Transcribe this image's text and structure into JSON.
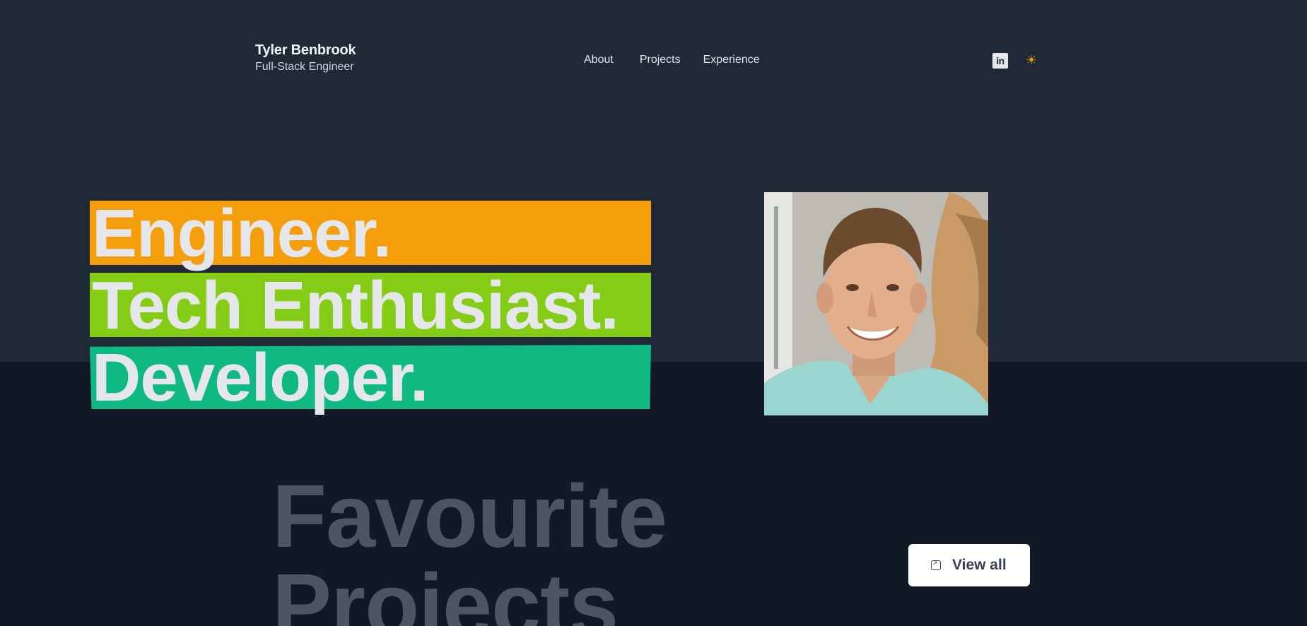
{
  "header": {
    "name": "Tyler Benbrook",
    "role": "Full-Stack Engineer",
    "nav": [
      "About",
      "Projects",
      "Experience"
    ],
    "social_icon": "linkedin-icon",
    "social_text": "in",
    "theme_icon": "sun-icon",
    "theme_glyph": "☀"
  },
  "hero": {
    "lines": [
      "Engineer.",
      "Tech Enthusiast.",
      "Developer."
    ],
    "colors": [
      "#f59e0b",
      "#84cc16",
      "#10b981"
    ],
    "photo_alt": "Portrait photo"
  },
  "projects": {
    "title_line1": "Favourite",
    "title_line2": "Projects",
    "view_all_label": "View all",
    "view_all_icon": "external-link-icon",
    "view_all_glyph": "↗"
  }
}
